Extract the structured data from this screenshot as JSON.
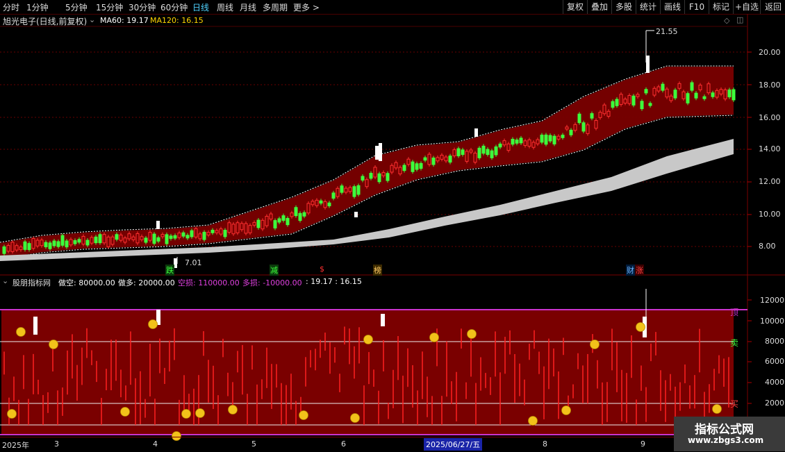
{
  "toolbar": {
    "periods": [
      "分时",
      "1分钟",
      "5分钟",
      "15分钟",
      "30分钟",
      "60分钟",
      "日线",
      "周线",
      "月线",
      "多周期",
      "更多"
    ],
    "active": "日线",
    "more_arrow": ">",
    "right_buttons": [
      "复权",
      "叠加",
      "多股",
      "统计",
      "画线",
      "F10",
      "标记",
      "+自选",
      "返回"
    ]
  },
  "main_header": {
    "title": "旭光电子(日线,前复权)",
    "ma60": "MA60: 19.17",
    "ma120": "MA120: 16.15"
  },
  "y_axis": [
    "20.00",
    "18.00",
    "16.00",
    "14.00",
    "12.00",
    "10.00",
    "8.00"
  ],
  "annotations": {
    "high": "21.55",
    "low": "7.01"
  },
  "markers": [
    {
      "text": "跌",
      "color": "#3cff3c",
      "bg": "#0c3c0c"
    },
    {
      "text": "减",
      "color": "#3cff3c",
      "bg": "#0c3c0c"
    },
    {
      "text": "$",
      "color": "#ff3030",
      "bg": "#000000"
    },
    {
      "text": "榜",
      "color": "#ffcc66",
      "bg": "#3c2a00"
    },
    {
      "text": "财",
      "color": "#6fb6ff",
      "bg": "#001c3c"
    },
    {
      "text": "涨",
      "color": "#ff4040",
      "bg": "#3c0000"
    }
  ],
  "indicator_header": {
    "name": "股朋指标网",
    "zuokong": "做空: 80000.00",
    "zuoduo": "做多: 20000.00",
    "kongsun": "空损: 110000.00",
    "duosun": "多损: -10000.00",
    "tail": ": 19.17 : 16.15"
  },
  "ind_y_axis": [
    "12000",
    "10000",
    "8000",
    "6000",
    "4000",
    "2000"
  ],
  "ind_labels": {
    "top": "顶",
    "sell": "卖",
    "buy": "买"
  },
  "x_axis": [
    "2025年",
    "3",
    "4",
    "5",
    "6",
    "2025/06/27/五",
    "8",
    "9"
  ],
  "watermark": {
    "line1": "指标公式网",
    "line2": "www.zbgs3.com"
  },
  "colors": {
    "band": "#7a0000",
    "up": "#ff3030",
    "down": "#3cff3c",
    "active": "#4fd2ff",
    "purple": "#cc33cc"
  }
}
